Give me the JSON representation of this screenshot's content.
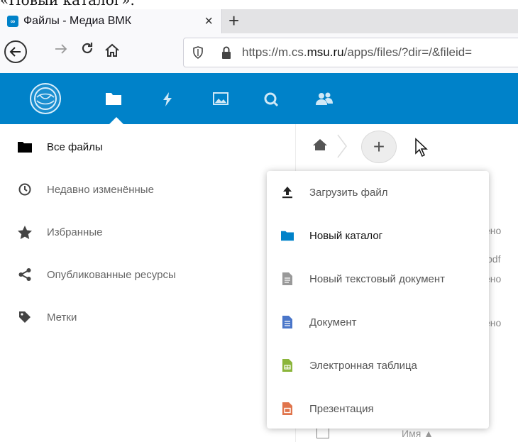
{
  "caption": "«Новый каталог».",
  "browser": {
    "tab_title": "Файлы - Медиа ВМК",
    "url_prefix": "https://m.cs.",
    "url_domain": "msu.ru",
    "url_rest": "/apps/files/?dir=/&fileid=",
    "new_tab": "+",
    "close": "×"
  },
  "colors": {
    "brand": "#0082c9",
    "folder": "#0082c9",
    "doc": "#4a76c9",
    "sheet": "#8bb53b",
    "slides": "#e0744b"
  },
  "header": {
    "icons": [
      "files-icon",
      "activity-icon",
      "gallery-icon",
      "search-icon",
      "contacts-icon"
    ]
  },
  "sidebar": {
    "items": [
      {
        "label": "Все файлы",
        "icon": "folder-icon"
      },
      {
        "label": "Недавно изменённые",
        "icon": "clock-icon"
      },
      {
        "label": "Избранные",
        "icon": "star-icon"
      },
      {
        "label": "Опубликованные ресурсы",
        "icon": "share-icon"
      },
      {
        "label": "Метки",
        "icon": "tag-icon"
      }
    ]
  },
  "content": {
    "add_label": "+",
    "bg_fragments": [
      "ено",
      "pdf",
      "ено",
      "ено"
    ],
    "name_column": "Имя ▲"
  },
  "new_menu": {
    "items": [
      {
        "label": "Загрузить файл",
        "icon": "upload-icon"
      },
      {
        "label": "Новый каталог",
        "icon": "folder-icon"
      },
      {
        "label": "Новый текстовый документ",
        "icon": "text-file-icon"
      },
      {
        "label": "Документ",
        "icon": "document-icon"
      },
      {
        "label": "Электронная таблица",
        "icon": "spreadsheet-icon"
      },
      {
        "label": "Презентация",
        "icon": "presentation-icon"
      }
    ]
  }
}
